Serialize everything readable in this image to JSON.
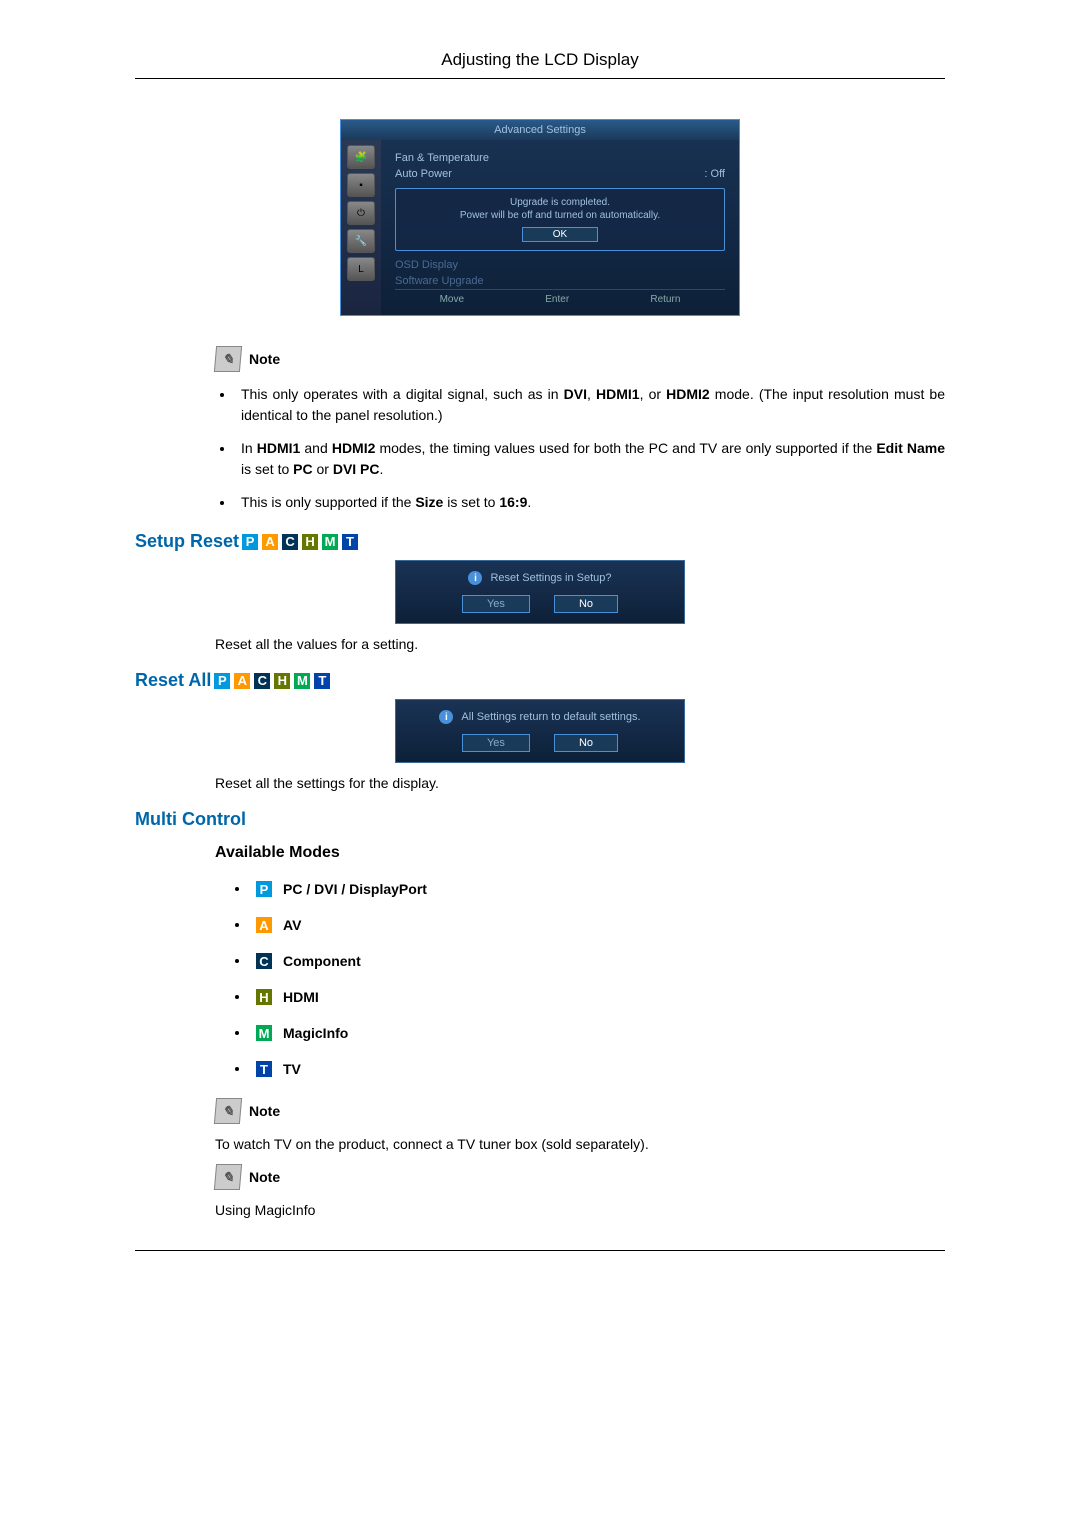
{
  "header": {
    "title": "Adjusting the LCD Display"
  },
  "osd1": {
    "title": "Advanced Settings",
    "row1_label": "Fan & Temperature",
    "row2_label": "Auto Power",
    "row2_value": ": Off",
    "popup_l1": "Upgrade is completed.",
    "popup_l2": "Power will be off and turned on automatically.",
    "popup_ok": "OK",
    "row3_label": "OSD Display",
    "row4_label": "Software Upgrade",
    "footer_move": "Move",
    "footer_enter": "Enter",
    "footer_return": "Return"
  },
  "note1": {
    "label": "Note"
  },
  "bullets1": {
    "b1_p1": "This only operates with a digital signal, such as in ",
    "b1_s1": "DVI",
    "b1_s2": "HDMI1",
    "b1_s3": "HDMI2",
    "b1_p2": " mode. (The input resolution must be identical to the panel resolution.)",
    "b2_p1": "In ",
    "b2_s1": "HDMI1",
    "b2_s2": "HDMI2",
    "b2_p2": " modes, the timing values used for both the PC and TV are only supported if the ",
    "b2_s3": "Edit Name",
    "b2_p3": " is set to ",
    "b2_s4": "PC",
    "b2_s5": "DVI PC",
    "b3_p1": "This is only supported if the ",
    "b3_s1": "Size",
    "b3_p2": " is set to ",
    "b3_s2": "16:9"
  },
  "setup_reset": {
    "title": "Setup Reset",
    "dialog_msg": "Reset Settings in Setup?",
    "yes": "Yes",
    "no": "No",
    "body": "Reset all the values for a setting."
  },
  "reset_all": {
    "title": "Reset All",
    "dialog_msg": "All Settings return to default settings.",
    "yes": "Yes",
    "no": "No",
    "body": "Reset all the settings for the display."
  },
  "multi": {
    "title": "Multi Control",
    "available": "Available Modes",
    "m_p": "PC / DVI / DisplayPort",
    "m_a": "AV",
    "m_c": "Component",
    "m_h": "HDMI",
    "m_m": "MagicInfo",
    "m_t": "TV"
  },
  "note2": {
    "label": "Note",
    "text": "To watch TV on the product, connect a TV tuner box (sold separately)."
  },
  "note3": {
    "label": "Note",
    "text": "Using MagicInfo"
  },
  "badge_letters": {
    "p": "P",
    "a": "A",
    "c": "C",
    "h": "H",
    "m": "M",
    "t": "T"
  }
}
